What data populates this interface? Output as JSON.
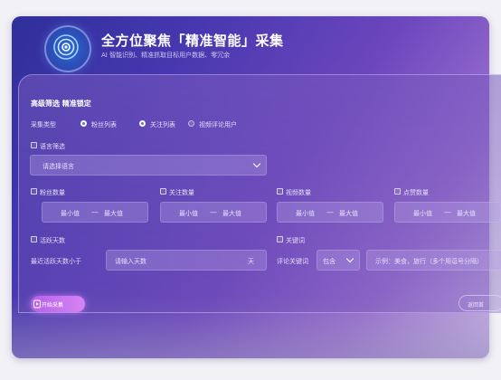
{
  "app": {
    "title": "全方位聚焦「精准智能」采集",
    "subtitle": "AI 智能识别、精准抓取目标用户数据、零冗余"
  },
  "panel": {
    "title": "高级筛选 精准锁定"
  },
  "collect_type": {
    "label": "采集类型",
    "options": [
      {
        "label": "粉丝列表",
        "selected": true
      },
      {
        "label": "关注列表",
        "selected": true
      },
      {
        "label": "视频评论用户",
        "selected": false
      }
    ]
  },
  "language": {
    "label": "语言筛选",
    "placeholder": "请选择语言"
  },
  "ranges": [
    {
      "label": "粉丝数量",
      "min": "最小值",
      "sep": "—",
      "max": "最大值"
    },
    {
      "label": "关注数量",
      "min": "最小值",
      "sep": "—",
      "max": "最大值"
    },
    {
      "label": "视频数量",
      "min": "最小值",
      "sep": "—",
      "max": "最大值"
    },
    {
      "label": "点赞数量",
      "min": "最小值",
      "sep": "—",
      "max": "最大值"
    }
  ],
  "active_days": {
    "label": "活跃天数",
    "row_label": "最近活跃天数小于",
    "placeholder": "请输入天数",
    "unit": "天"
  },
  "keyword": {
    "label": "关键词",
    "row_label": "评论关键词",
    "mode": "包含",
    "placeholder": "示例：美食，旅行（多个用逗号分隔）"
  },
  "buttons": {
    "start": "开始采集",
    "return": "返回首"
  },
  "colors": {
    "accent": "#5b6ff5",
    "start_button": "#c873ef"
  }
}
